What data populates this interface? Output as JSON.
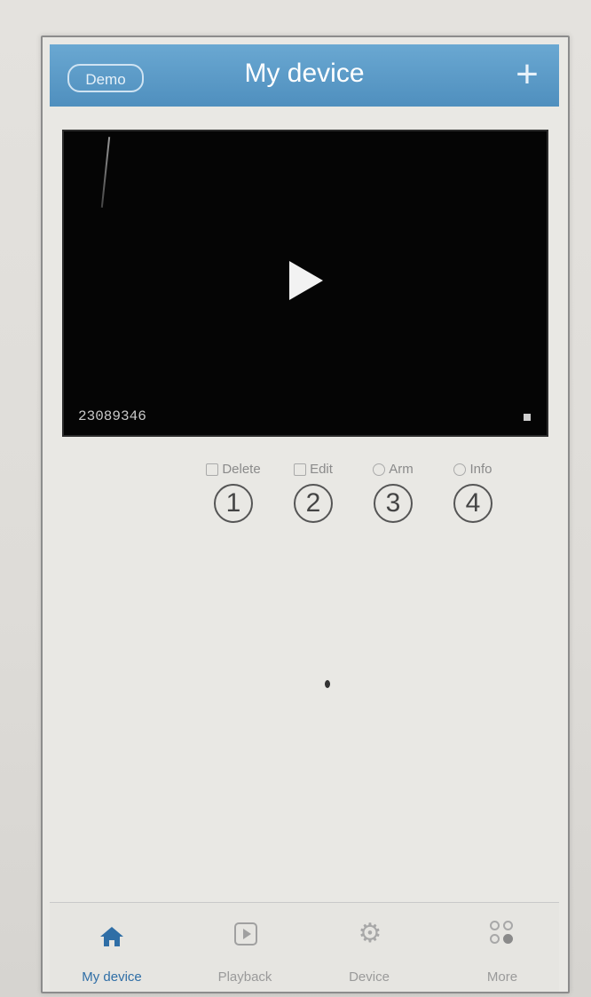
{
  "header": {
    "demo_label": "Demo",
    "title": "My device",
    "add_label": "+"
  },
  "video": {
    "device_id": "23089346"
  },
  "actions": [
    {
      "label": "Delete",
      "number": "1"
    },
    {
      "label": "Edit",
      "number": "2"
    },
    {
      "label": "Arm",
      "number": "3"
    },
    {
      "label": "Info",
      "number": "4"
    }
  ],
  "tabs": [
    {
      "label": "My device",
      "icon": "home-icon",
      "active": true
    },
    {
      "label": "Playback",
      "icon": "play-box-icon",
      "active": false
    },
    {
      "label": "Device",
      "icon": "gear-icon",
      "active": false
    },
    {
      "label": "More",
      "icon": "grid-icon",
      "active": false
    }
  ],
  "colors": {
    "header": "#5a9bc8",
    "active_tab": "#2f6ea6",
    "video_bg": "#050505"
  }
}
